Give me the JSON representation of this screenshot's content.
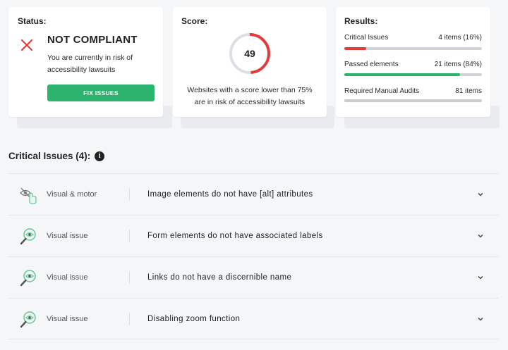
{
  "status": {
    "heading": "Status:",
    "title": "NOT COMPLIANT",
    "text": "You are currently in risk of accessibility lawsuits",
    "button_label": "FIX ISSUES"
  },
  "score": {
    "heading": "Score:",
    "value": "49",
    "percent": 49,
    "text": "Websites with a score lower than 75% are in risk of accessibility lawsuits"
  },
  "results": {
    "heading": "Results:",
    "rows": [
      {
        "label": "Critical Issues",
        "value": "4 items (16%)",
        "fraction": 0.16,
        "color": "#e23b3b"
      },
      {
        "label": "Passed elements",
        "value": "21 items (84%)",
        "fraction": 0.84,
        "color": "#2cb36d"
      },
      {
        "label": "Required Manual Audits",
        "value": "81 items",
        "fraction": 1.0,
        "color": "#c9ccd0"
      }
    ]
  },
  "critical": {
    "title": "Critical Issues (4):",
    "info_icon": "info-icon",
    "issues": [
      {
        "icon": "eye-hand-icon",
        "category": "Visual & motor",
        "description": "Image elements do not have [alt] attributes"
      },
      {
        "icon": "magnifier-eye-icon",
        "category": "Visual issue",
        "description": "Form elements do not have associated labels"
      },
      {
        "icon": "magnifier-eye-icon",
        "category": "Visual issue",
        "description": "Links do not have a discernible name"
      },
      {
        "icon": "magnifier-eye-icon",
        "category": "Visual issue",
        "description": "Disabling zoom function"
      }
    ]
  },
  "colors": {
    "danger": "#e23b3b",
    "success": "#2cb36d",
    "icon_green": "#6cc49a"
  }
}
